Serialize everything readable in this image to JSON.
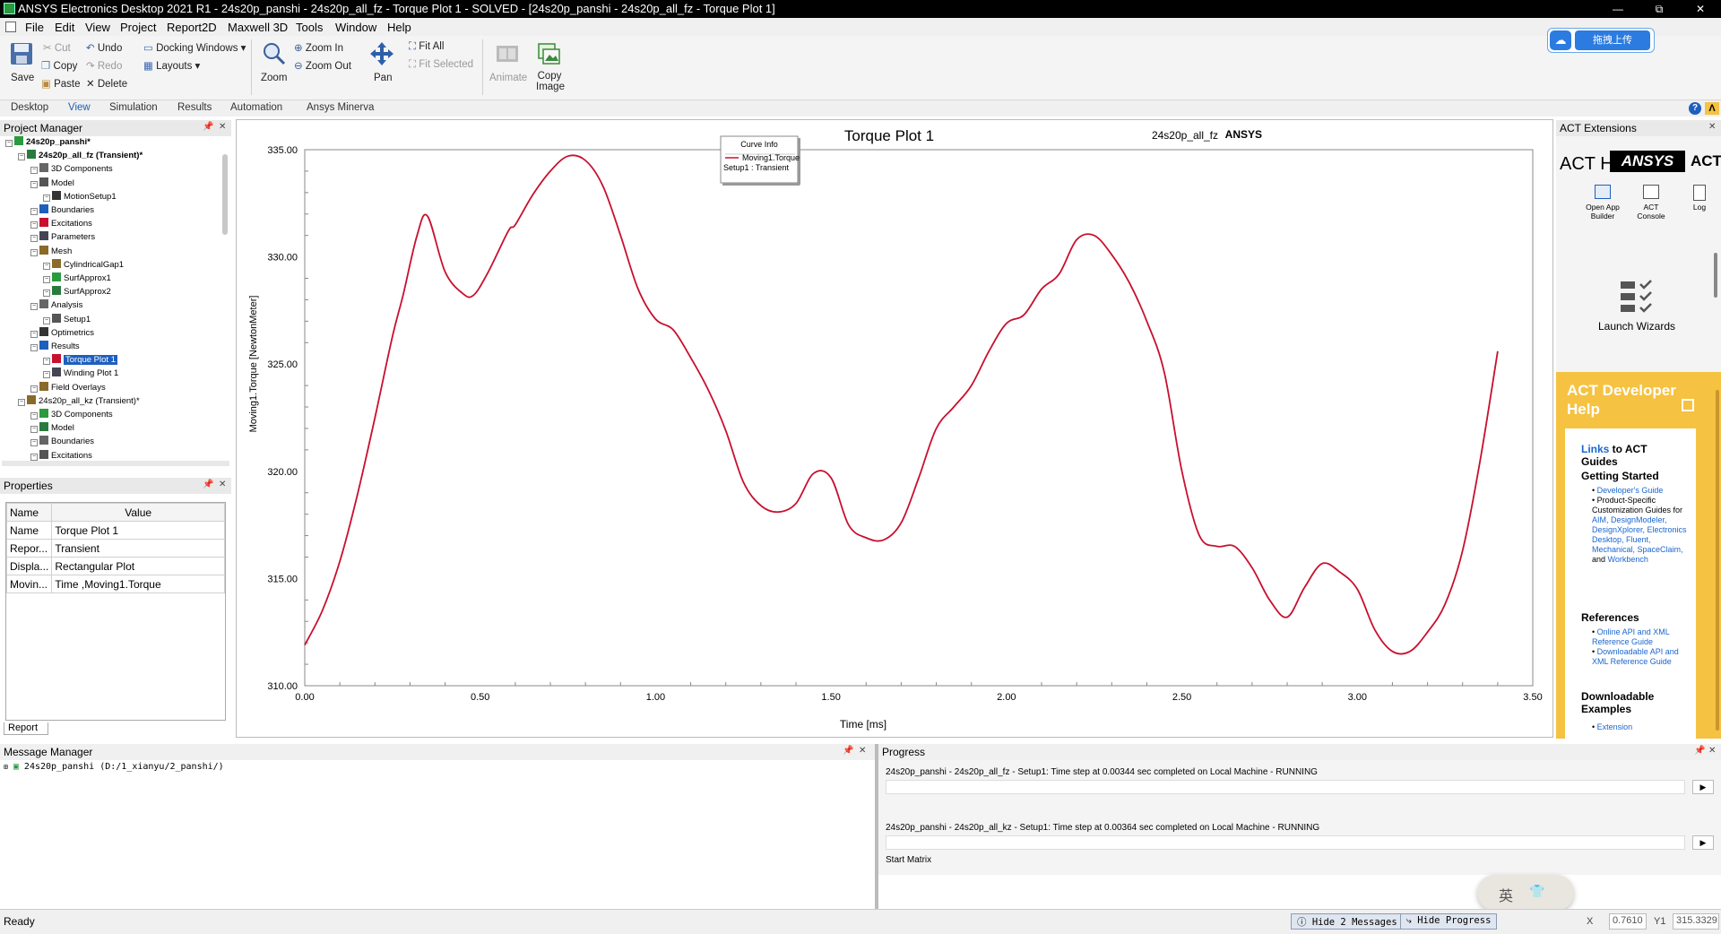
{
  "window": {
    "title": "ANSYS Electronics Desktop 2021 R1 - 24s20p_panshi - 24s20p_all_fz - Torque Plot 1 - SOLVED - [24s20p_panshi - 24s20p_all_fz - Torque Plot 1]",
    "min": "—",
    "max": "⧉",
    "close": "✕"
  },
  "menu": [
    "File",
    "Edit",
    "View",
    "Project",
    "Report2D",
    "Maxwell 3D",
    "Tools",
    "Window",
    "Help"
  ],
  "ribbon": {
    "save": "Save",
    "cut": "Cut",
    "copy": "Copy",
    "paste": "Paste",
    "undo": "Undo",
    "redo": "Redo",
    "delete": "Delete",
    "docking": "Docking Windows",
    "layouts": "Layouts",
    "zoom": "Zoom",
    "zoom_in": "Zoom In",
    "zoom_out": "Zoom Out",
    "pan": "Pan",
    "fit_all": "Fit All",
    "fit_selected": "Fit Selected",
    "animate": "Animate",
    "copy_image": "Copy Image",
    "upload": "拖拽上传"
  },
  "tabs": [
    "Desktop",
    "View",
    "Simulation",
    "Results",
    "Automation",
    "Ansys Minerva"
  ],
  "project_manager": {
    "title": "Project Manager",
    "rows": [
      {
        "label": "24s20p_panshi*",
        "depth": 0,
        "bold": true
      },
      {
        "label": "24s20p_all_fz (Transient)*",
        "depth": 1,
        "bold": true
      },
      {
        "label": "3D Components",
        "depth": 2
      },
      {
        "label": "Model",
        "depth": 2
      },
      {
        "label": "MotionSetup1",
        "depth": 3
      },
      {
        "label": "Boundaries",
        "depth": 2
      },
      {
        "label": "Excitations",
        "depth": 2
      },
      {
        "label": "Parameters",
        "depth": 2
      },
      {
        "label": "Mesh",
        "depth": 2
      },
      {
        "label": "CylindricalGap1",
        "depth": 3
      },
      {
        "label": "SurfApprox1",
        "depth": 3
      },
      {
        "label": "SurfApprox2",
        "depth": 3
      },
      {
        "label": "Analysis",
        "depth": 2
      },
      {
        "label": "Setup1",
        "depth": 3
      },
      {
        "label": "Optimetrics",
        "depth": 2
      },
      {
        "label": "Results",
        "depth": 2
      },
      {
        "label": "Torque Plot 1",
        "depth": 3,
        "selected": true
      },
      {
        "label": "Winding Plot 1",
        "depth": 3
      },
      {
        "label": "Field Overlays",
        "depth": 2
      },
      {
        "label": "24s20p_all_kz (Transient)*",
        "depth": 1
      },
      {
        "label": "3D Components",
        "depth": 2
      },
      {
        "label": "Model",
        "depth": 2
      },
      {
        "label": "Boundaries",
        "depth": 2
      },
      {
        "label": "Excitations",
        "depth": 2
      }
    ]
  },
  "properties": {
    "title": "Properties",
    "headers": [
      "Name",
      "Value"
    ],
    "rows": [
      [
        "Name",
        "Torque Plot 1"
      ],
      [
        "Repor...",
        "Transient"
      ],
      [
        "Displa...",
        "Rectangular Plot"
      ],
      [
        "Movin...",
        "Time ,Moving1.Torque"
      ]
    ],
    "tab": "Report"
  },
  "plot": {
    "header_right": "24s20p_all_fz",
    "brand": "ANSYS",
    "legend_title": "Curve Info",
    "legend_series": "Moving1.Torque",
    "legend_setup": "Setup1 : Transient"
  },
  "chart_data": {
    "type": "line",
    "title": "Torque Plot 1",
    "xlabel": "Time [ms]",
    "ylabel": "Moving1.Torque [NewtonMeter]",
    "xlim": [
      0,
      3.5
    ],
    "ylim": [
      310,
      335
    ],
    "xticks": [
      "0.00",
      "0.50",
      "1.00",
      "1.50",
      "2.00",
      "2.50",
      "3.00",
      "3.50"
    ],
    "yticks": [
      "310.00",
      "315.00",
      "320.00",
      "325.00",
      "330.00",
      "335.00"
    ],
    "grid": true,
    "legend": "top-center",
    "series": [
      {
        "name": "Moving1.Torque",
        "color": "#c8102e",
        "x": [
          0,
          0.05,
          0.1,
          0.15,
          0.2,
          0.25,
          0.28,
          0.32,
          0.35,
          0.4,
          0.45,
          0.48,
          0.52,
          0.58,
          0.6,
          0.65,
          0.7,
          0.75,
          0.8,
          0.85,
          0.9,
          0.95,
          1.0,
          1.05,
          1.1,
          1.15,
          1.2,
          1.25,
          1.3,
          1.35,
          1.4,
          1.45,
          1.5,
          1.55,
          1.6,
          1.65,
          1.7,
          1.75,
          1.8,
          1.85,
          1.9,
          1.95,
          2.0,
          2.05,
          2.1,
          2.15,
          2.2,
          2.25,
          2.3,
          2.35,
          2.4,
          2.45,
          2.5,
          2.55,
          2.6,
          2.65,
          2.7,
          2.75,
          2.8,
          2.85,
          2.9,
          2.95,
          3.0,
          3.05,
          3.1,
          3.15,
          3.2,
          3.25,
          3.3,
          3.35,
          3.4
        ],
        "values": [
          311.9,
          313.5,
          315.8,
          318.9,
          322.5,
          326.3,
          328.2,
          331.0,
          331.9,
          329.3,
          328.3,
          328.2,
          329.2,
          331.2,
          331.5,
          332.9,
          334.0,
          334.7,
          334.5,
          333.3,
          331.0,
          328.5,
          327.1,
          326.6,
          325.3,
          323.8,
          321.9,
          319.5,
          318.4,
          318.1,
          318.5,
          319.9,
          319.7,
          317.5,
          316.9,
          316.8,
          317.6,
          319.7,
          322.0,
          323.0,
          324.0,
          325.6,
          326.9,
          327.3,
          328.5,
          329.2,
          330.8,
          331.0,
          330.1,
          328.8,
          327.0,
          324.6,
          320.0,
          317.0,
          316.5,
          316.5,
          315.5,
          314.0,
          313.2,
          314.6,
          315.7,
          315.3,
          314.5,
          312.6,
          311.6,
          311.6,
          312.5,
          313.8,
          316.3,
          320.5,
          325.6
        ]
      }
    ]
  },
  "act": {
    "title": "ACT Extensions",
    "heading": "ACT H",
    "logo": "ANSYS",
    "act_label": "ACT",
    "open_app_builder": "Open App Builder",
    "act_console": "ACT Console",
    "log": "Log",
    "launch_wizards": "Launch Wizards",
    "dev_help": "ACT Developer Help",
    "links_word": "Links",
    "links_rest": " to ACT Guides",
    "getting_started": "Getting Started",
    "gs_item1": "Developer's Guide",
    "gs_item2_prefix": "Product-Specific Customization Guides for ",
    "gs_item2_links": "AIM, DesignModeler, DesignXplorer, Electronics Desktop, Fluent, Mechanical, SpaceClaim,",
    "gs_item2_and": " and ",
    "gs_item2_last": "Workbench",
    "references": "References",
    "ref1": "Online API and XML Reference Guide",
    "ref2": "Downloadable API and XML Reference Guide",
    "downloadable_examples": "Downloadable Examples",
    "de1": "Extension"
  },
  "message_manager": {
    "title": "Message Manager",
    "entry": "24s20p_panshi (D:/1_xianyu/2_panshi/)"
  },
  "progress": {
    "title": "Progress",
    "line1": "24s20p_panshi - 24s20p_all_fz - Setup1: Time step at 0.00344 sec completed on Local Machine - RUNNING",
    "line2": "24s20p_panshi - 24s20p_all_kz - Setup1: Time step at 0.00364 sec completed on Local Machine - RUNNING",
    "line3": "Start Matrix",
    "ime": "英"
  },
  "status": {
    "ready": "Ready",
    "hide_messages": "Hide 2 Messages",
    "hide_progress": "Hide Progress",
    "x_label": "X",
    "x_value": "0.7610",
    "y_label": "Y1",
    "y_value": "315.3329"
  }
}
